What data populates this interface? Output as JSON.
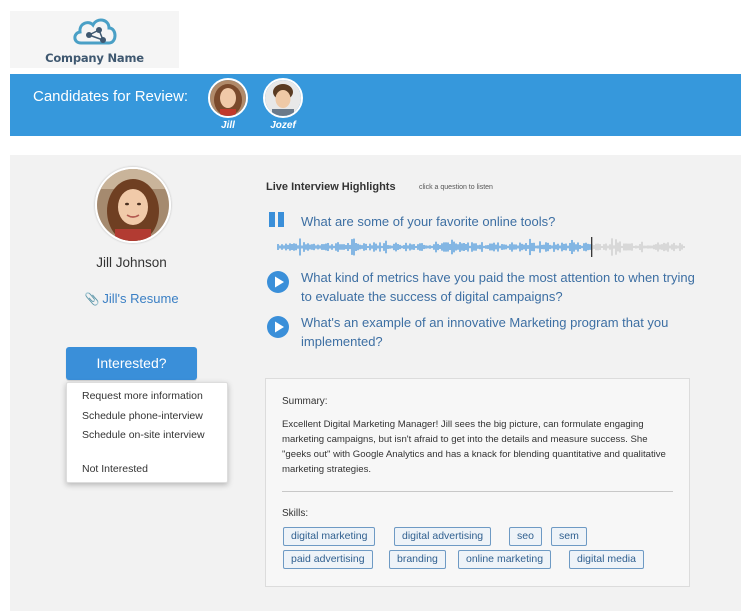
{
  "logo": {
    "company_name": "Company Name",
    "icon": "cloud-network-icon"
  },
  "banner": {
    "title": "Candidates for Review:",
    "candidates": [
      {
        "name": "Jill"
      },
      {
        "name": "Jozef"
      }
    ]
  },
  "profile": {
    "name": "Jill Johnson",
    "resume_label": "Jill's Resume",
    "resume_icon": "paperclip-icon"
  },
  "interested": {
    "button_label": "Interested?",
    "options": [
      "Request more information",
      "Schedule phone-interview",
      "Schedule on-site interview",
      "Not Interested"
    ]
  },
  "highlights": {
    "title": "Live Interview Highlights",
    "hint": "click a question to listen",
    "questions": [
      {
        "text": "What are some of your favorite online tools?",
        "state": "playing",
        "icon": "pause-icon"
      },
      {
        "text": "What kind of metrics have you paid the most attention to when trying to evaluate the success of digital campaigns?",
        "state": "paused",
        "icon": "play-icon"
      },
      {
        "text": "What's an example of an innovative Marketing program that you implemented?",
        "state": "paused",
        "icon": "play-icon"
      }
    ],
    "playback_progress": 0.77
  },
  "summary": {
    "label": "Summary:",
    "text": "Excellent Digital Marketing Manager! Jill sees the big picture, can formulate engaging marketing campaigns, but isn't afraid to get into the details and measure success. She \"geeks out\" with Google Analytics and has a knack for blending quantitative and qualitative marketing strategies.",
    "skills_label": "Skills:",
    "skills": [
      "digital marketing",
      "digital advertising",
      "seo",
      "sem",
      "paid advertising",
      "branding",
      "online marketing",
      "digital media"
    ]
  },
  "colors": {
    "banner": "#3698dc",
    "accent": "#3a8fd9",
    "link": "#3a7fc4",
    "question_text": "#3d6fa3",
    "wave_played": "#3a8fd9",
    "wave_unplayed": "#c8c8c8"
  }
}
